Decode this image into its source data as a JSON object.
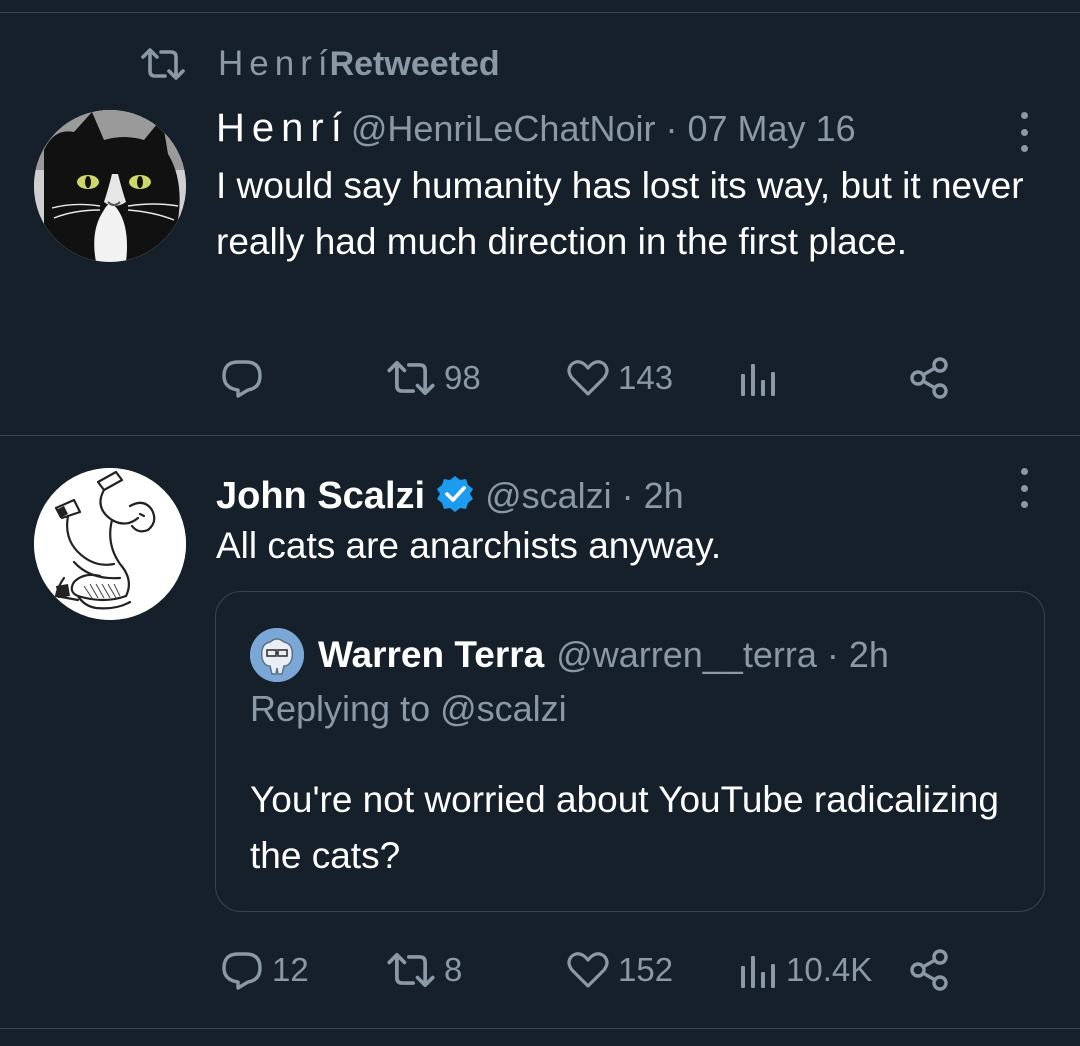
{
  "tweet1": {
    "retweet_name": "Henrí",
    "retweet_suffix": "Retweeted",
    "display_name": "Henrí",
    "handle": "@HenriLeChatNoir",
    "separator": "·",
    "time": "07 May 16",
    "text": "I would say humanity has lost its way, but it never really had much direction in the first place.",
    "retweets": "98",
    "likes": "143"
  },
  "tweet2": {
    "display_name": "John Scalzi",
    "handle": "@scalzi",
    "separator": "·",
    "time": "2h",
    "text": "All cats are anarchists anyway.",
    "replies": "12",
    "retweets": "8",
    "likes": "152",
    "views": "10.4K",
    "quote": {
      "display_name": "Warren Terra",
      "handle": "@warren__terra",
      "separator": "·",
      "time": "2h",
      "replying_to": "Replying to @scalzi",
      "text": "You're not worried about YouTube radicalizing the cats?"
    }
  },
  "colors": {
    "background": "#15202b",
    "muted_text": "#8b98a5",
    "divider": "#38444d",
    "verified": "#1d9bf0"
  },
  "icons": [
    "retweet-icon",
    "reply-icon",
    "like-icon",
    "views-icon",
    "share-icon",
    "more-icon",
    "verified-badge-icon"
  ]
}
